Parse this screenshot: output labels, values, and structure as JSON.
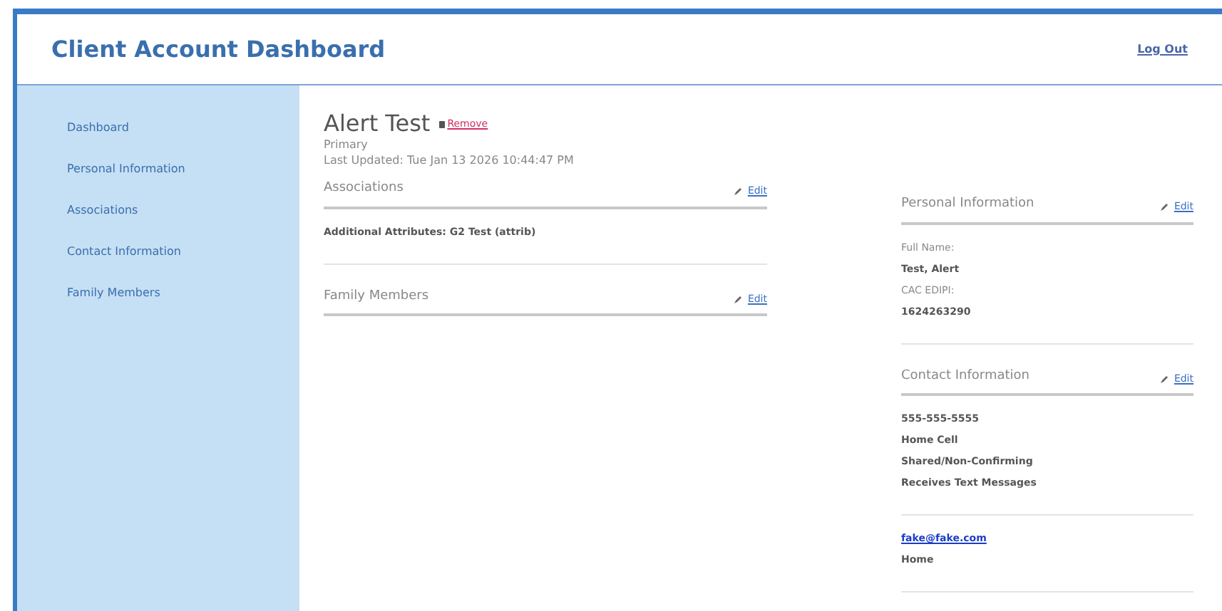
{
  "header": {
    "title": "Client Account Dashboard",
    "logout": "Log Out"
  },
  "nav": [
    "Dashboard",
    "Personal Information",
    "Associations",
    "Contact Information",
    "Family Members"
  ],
  "client": {
    "name": "Alert Test",
    "remove": "Remove",
    "role": "Primary",
    "updated": "Last Updated: Tue Jan 13 2026 10:44:47 PM"
  },
  "columns": [
    [
      {
        "title": "Associations",
        "edit": "Edit",
        "groups": [
          [
            {
              "kind": "value",
              "text": "Additional Attributes: G2 Test (attrib)"
            }
          ]
        ]
      },
      {
        "title": "Family Members",
        "edit": "Edit"
      }
    ],
    [
      {
        "title": "Personal Information",
        "edit": "Edit",
        "groups": [
          [
            {
              "kind": "label",
              "text": "Full Name:"
            },
            {
              "kind": "value",
              "text": "Test, Alert"
            },
            {
              "kind": "label",
              "text": "CAC EDIPI:"
            },
            {
              "kind": "value",
              "text": "1624263290"
            }
          ]
        ]
      },
      {
        "title": "Contact Information",
        "edit": "Edit",
        "groups": [
          [
            {
              "kind": "value",
              "text": "555-555-5555"
            },
            {
              "kind": "value",
              "text": "Home Cell"
            },
            {
              "kind": "value",
              "text": "Shared/Non-Confirming"
            },
            {
              "kind": "value",
              "text": "Receives Text Messages"
            }
          ],
          [
            {
              "kind": "link",
              "text": "fake@fake.com"
            },
            {
              "kind": "value",
              "text": "Home"
            }
          ]
        ]
      }
    ]
  ]
}
